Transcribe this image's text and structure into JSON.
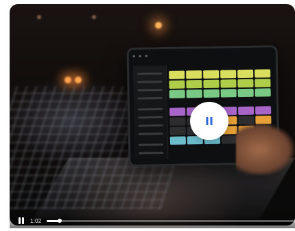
{
  "player": {
    "time": "1:02",
    "progress": 0.05,
    "state": "paused",
    "icons": {
      "center": "pause-icon",
      "bar": "pause-icon"
    }
  },
  "ipad_ui": {
    "clip_colors": [
      "#e6ea63",
      "#b7d84d",
      "#7fd38a",
      "#b06ad3",
      "#f2a93a",
      "#71c6d6"
    ]
  }
}
